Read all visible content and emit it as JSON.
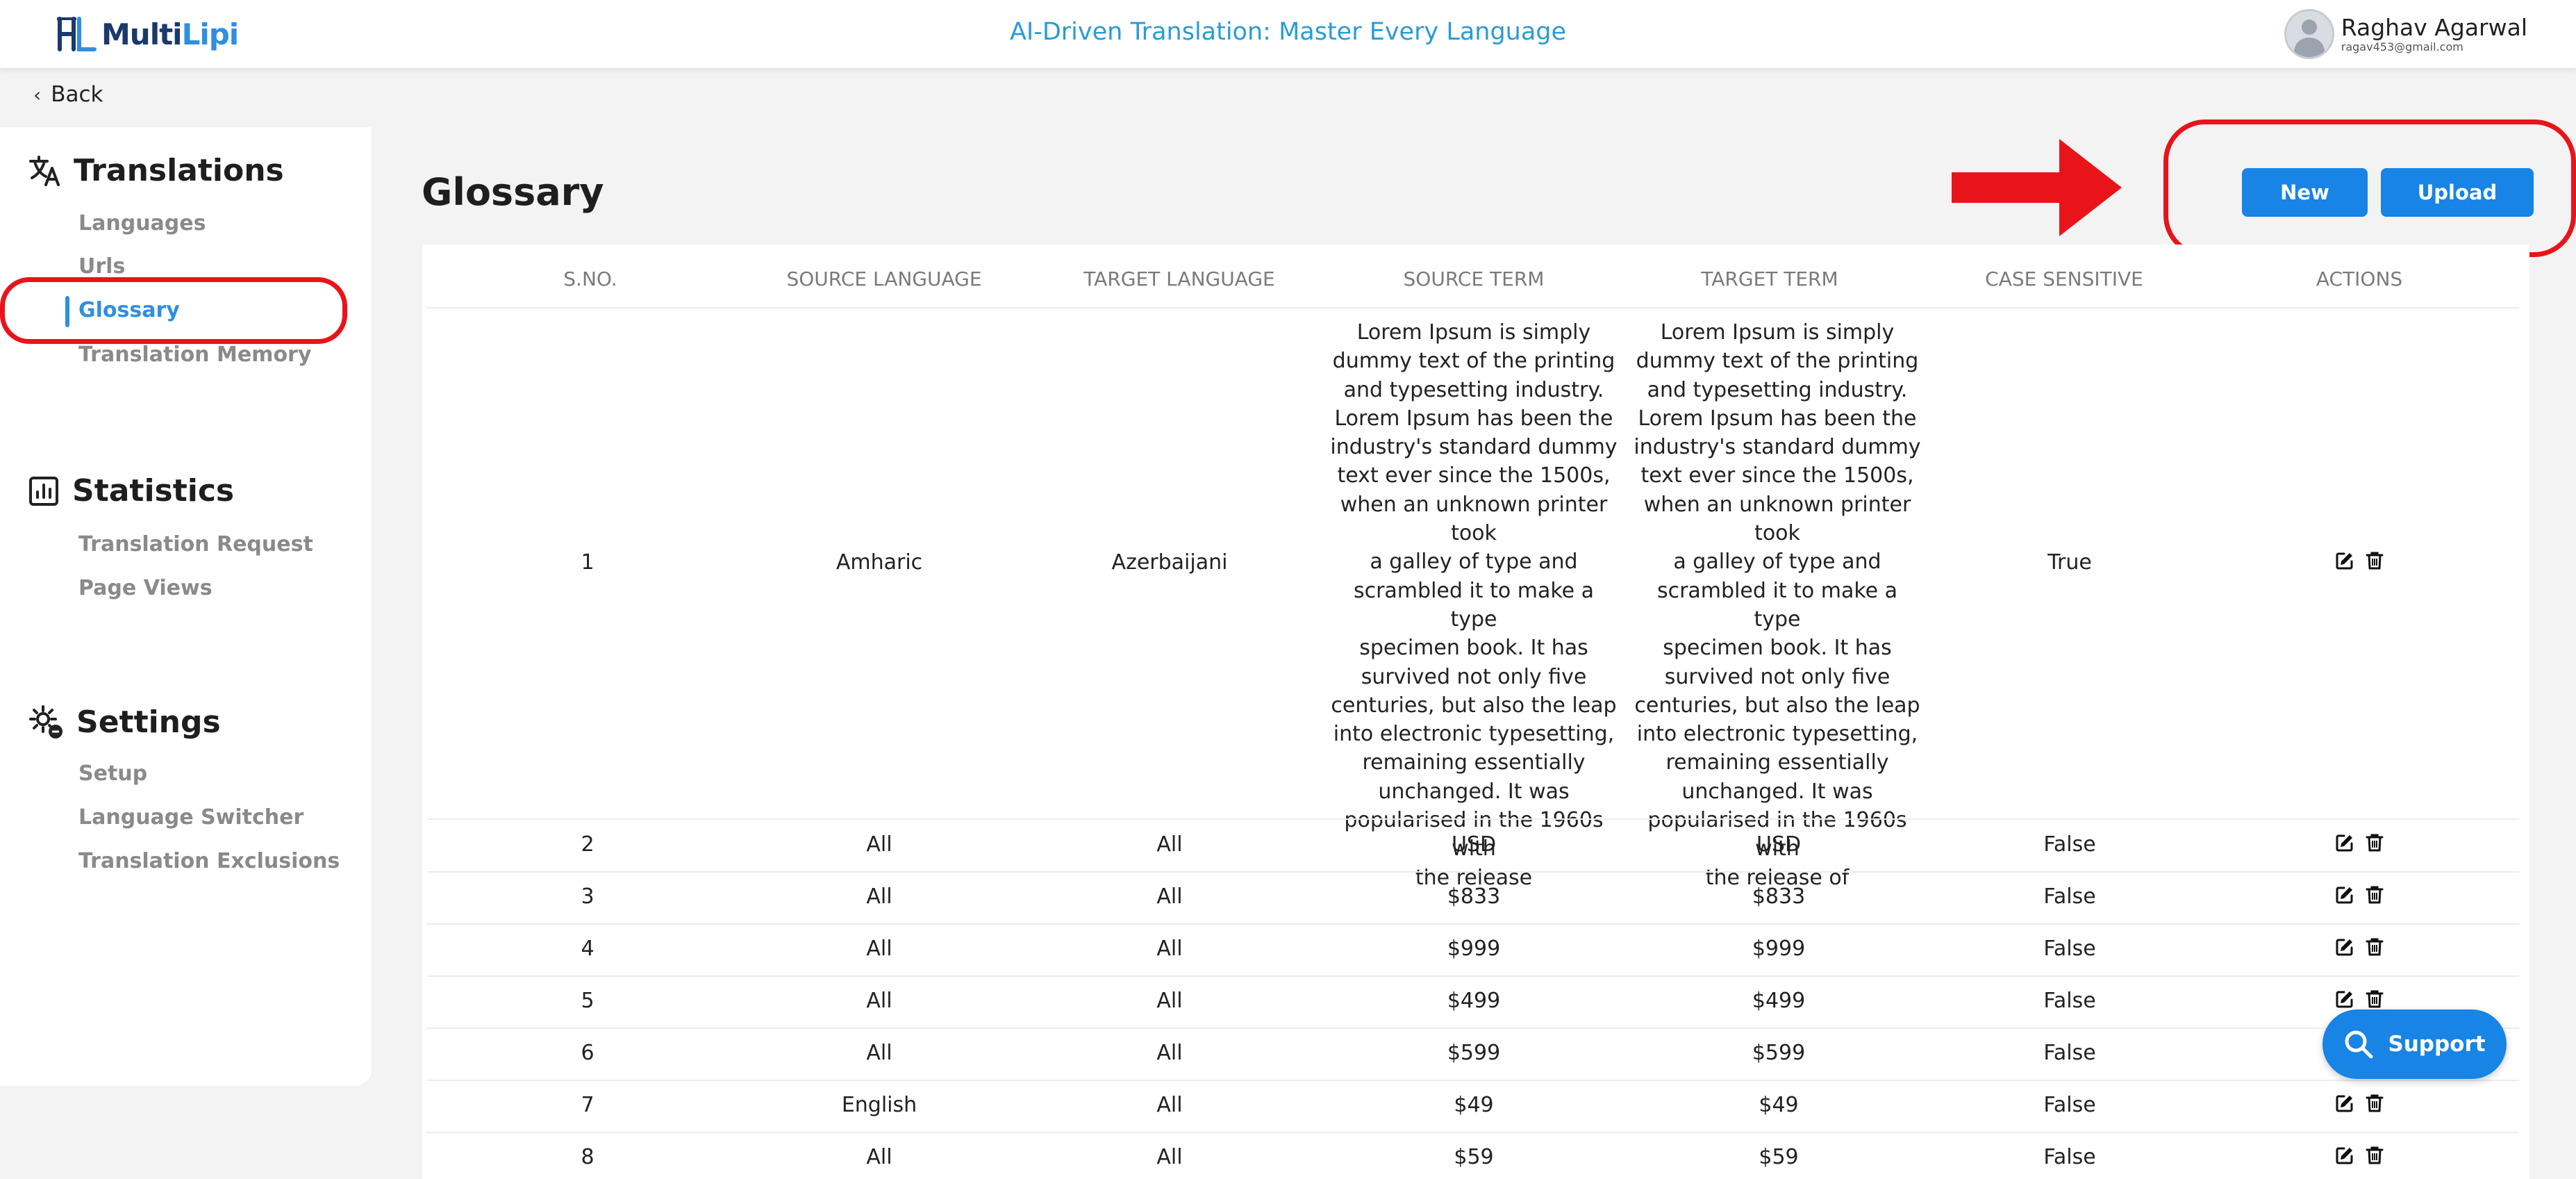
{
  "header": {
    "logo_part1": "Multi",
    "logo_part2": "Lipi",
    "tagline": "AI-Driven Translation: Master Every Language",
    "user_name": "Raghav Agarwal",
    "user_email": "ragav453@gmail.com"
  },
  "back_label": "Back",
  "sidebar": {
    "sections": [
      {
        "title": "Translations",
        "icon": "translate-icon",
        "items": [
          "Languages",
          "Urls",
          "Glossary",
          "Translation Memory"
        ]
      },
      {
        "title": "Statistics",
        "icon": "chart-icon",
        "items": [
          "Translation Request",
          "Page Views"
        ]
      },
      {
        "title": "Settings",
        "icon": "gear-icon",
        "items": [
          "Setup",
          "Language Switcher",
          "Translation Exclusions"
        ]
      }
    ],
    "active_item": "Glossary"
  },
  "page": {
    "title": "Glossary",
    "new_label": "New",
    "upload_label": "Upload"
  },
  "table": {
    "columns": [
      "S.NO.",
      "SOURCE LANGUAGE",
      "TARGET LANGUAGE",
      "SOURCE TERM",
      "TARGET TERM",
      "CASE SENSITIVE",
      "ACTIONS"
    ],
    "row1": {
      "sno": "1",
      "source_language": "Amharic",
      "target_language": "Azerbaijani",
      "source_term_lines": [
        "Lorem Ipsum is simply",
        "dummy text of the printing",
        "and typesetting industry.",
        "Lorem Ipsum has been the",
        "industry's standard dummy",
        "text ever since the 1500s,",
        "when an unknown printer took",
        "a galley of type and",
        "scrambled it to make a type",
        "specimen book. It has",
        "survived not only five",
        "centuries, but also the leap",
        "into electronic typesetting,",
        "remaining essentially",
        "unchanged. It was",
        "popularised in the 1960s with",
        "the release"
      ],
      "target_term_lines": [
        "Lorem Ipsum is simply",
        "dummy text of the printing",
        "and typesetting industry.",
        "Lorem Ipsum has been the",
        "industry's standard dummy",
        "text ever since the 1500s,",
        "when an unknown printer took",
        "a galley of type and",
        "scrambled it to make a type",
        "specimen book. It has",
        "survived not only five",
        "centuries, but also the leap",
        "into electronic typesetting,",
        "remaining essentially",
        "unchanged. It was",
        "popularised in the 1960s with",
        "the release of"
      ],
      "case_sensitive": "True"
    },
    "rows": [
      {
        "sno": "2",
        "source_language": "All",
        "target_language": "All",
        "source_term": "USD",
        "target_term": "USD",
        "case_sensitive": "False"
      },
      {
        "sno": "3",
        "source_language": "All",
        "target_language": "All",
        "source_term": "$833",
        "target_term": "$833",
        "case_sensitive": "False"
      },
      {
        "sno": "4",
        "source_language": "All",
        "target_language": "All",
        "source_term": "$999",
        "target_term": "$999",
        "case_sensitive": "False"
      },
      {
        "sno": "5",
        "source_language": "All",
        "target_language": "All",
        "source_term": "$499",
        "target_term": "$499",
        "case_sensitive": "False"
      },
      {
        "sno": "6",
        "source_language": "All",
        "target_language": "All",
        "source_term": "$599",
        "target_term": "$599",
        "case_sensitive": "False"
      },
      {
        "sno": "7",
        "source_language": "English",
        "target_language": "All",
        "source_term": "$49",
        "target_term": "$49",
        "case_sensitive": "False"
      },
      {
        "sno": "8",
        "source_language": "All",
        "target_language": "All",
        "source_term": "$59",
        "target_term": "$59",
        "case_sensitive": "False"
      }
    ],
    "action_icons": [
      "edit-icon",
      "delete-icon"
    ]
  },
  "support_label": "Support",
  "colors": {
    "accent": "#1784e6",
    "annotation": "#e8141a",
    "tagline": "#2a9bd6"
  }
}
